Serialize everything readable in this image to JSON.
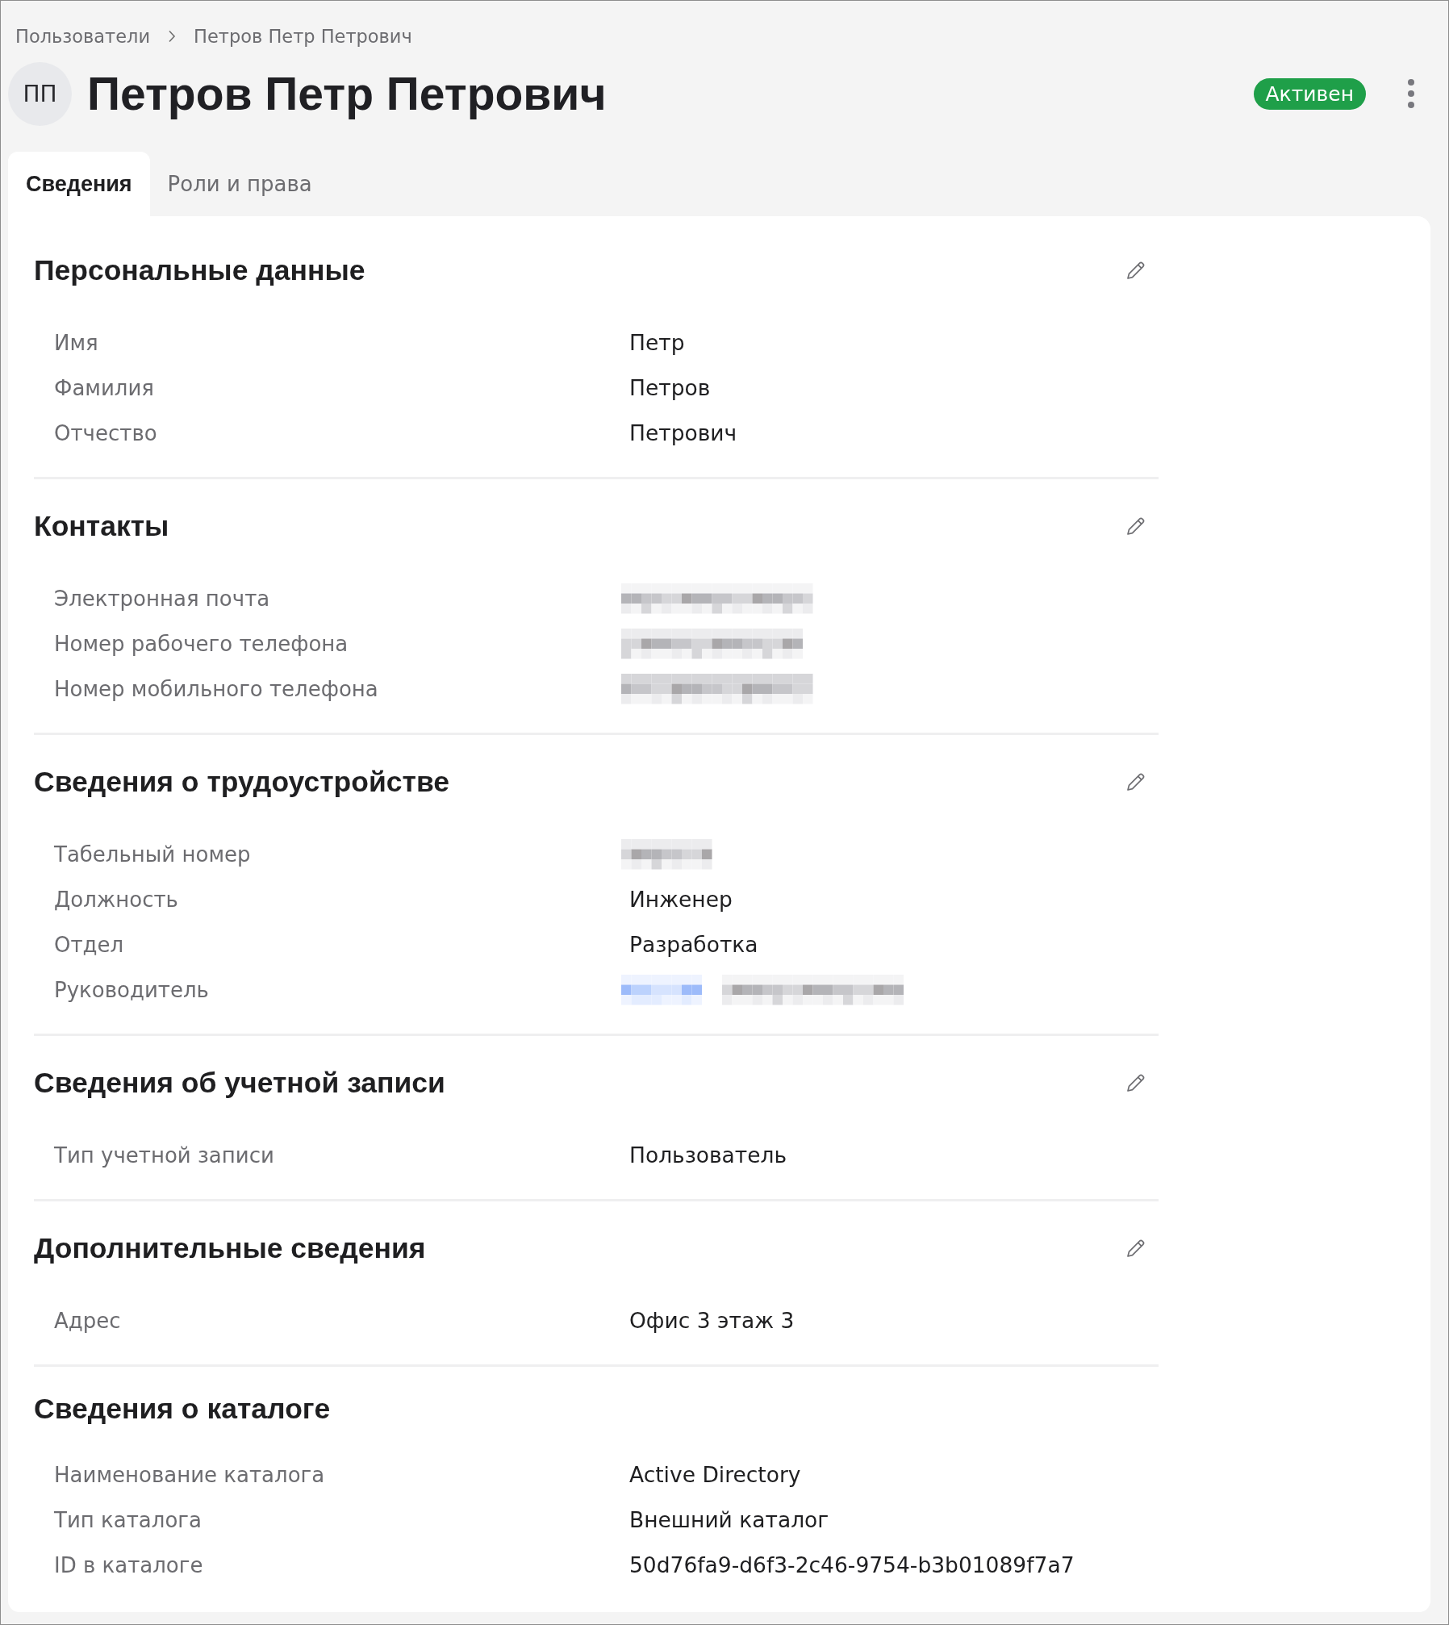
{
  "breadcrumbs": [
    {
      "label": "Пользователи"
    },
    {
      "label": "Петров Петр Петрович"
    }
  ],
  "header": {
    "avatar": {
      "initials": "ПП"
    },
    "title": "Петров Петр Петрович",
    "status": {
      "label": "Активен",
      "active": true
    }
  },
  "tabs": [
    {
      "label": "Сведения",
      "selected": true
    },
    {
      "label": "Роли и права",
      "selected": false
    }
  ],
  "sections": [
    {
      "title": "Персональные данные",
      "editable": true,
      "rows": [
        {
          "label": "Имя",
          "kind": "text",
          "value": "Петр"
        },
        {
          "label": "Фамилия",
          "kind": "text",
          "value": "Петров"
        },
        {
          "label": "Отчество",
          "kind": "text",
          "value": "Петрович"
        }
      ]
    },
    {
      "title": "Контакты",
      "editable": true,
      "rows": [
        {
          "label": "Электронная почта",
          "kind": "redacted"
        },
        {
          "label": "Номер рабочего телефона",
          "kind": "redacted"
        },
        {
          "label": "Номер мобильного телефона",
          "kind": "redacted"
        }
      ]
    },
    {
      "title": "Сведения о трудоустройстве",
      "editable": true,
      "rows": [
        {
          "label": "Табельный номер",
          "kind": "redacted"
        },
        {
          "label": "Должность",
          "kind": "text",
          "value": "Инженер"
        },
        {
          "label": "Отдел",
          "kind": "text",
          "value": "Разработка"
        },
        {
          "label": "Руководитель",
          "kind": "redacted_link"
        }
      ]
    },
    {
      "title": "Сведения об учетной записи",
      "editable": true,
      "rows": [
        {
          "label": "Тип учетной записи",
          "kind": "text",
          "value": "Пользователь"
        }
      ]
    },
    {
      "title": "Дополнительные сведения",
      "editable": true,
      "rows": [
        {
          "label": "Адрес",
          "kind": "text",
          "value": "Офис 3 этаж 3"
        }
      ]
    },
    {
      "title": "Сведения о каталоге",
      "editable": false,
      "rows": [
        {
          "label": "Наименование каталога",
          "kind": "text",
          "value": "Active Directory"
        },
        {
          "label": "Тип каталога",
          "kind": "text",
          "value": "Внешний каталог"
        },
        {
          "label": "ID в каталоге",
          "kind": "text",
          "value": "50d76fa9-d6f3-2c46-9754-b3b01089f7a7"
        }
      ]
    }
  ]
}
